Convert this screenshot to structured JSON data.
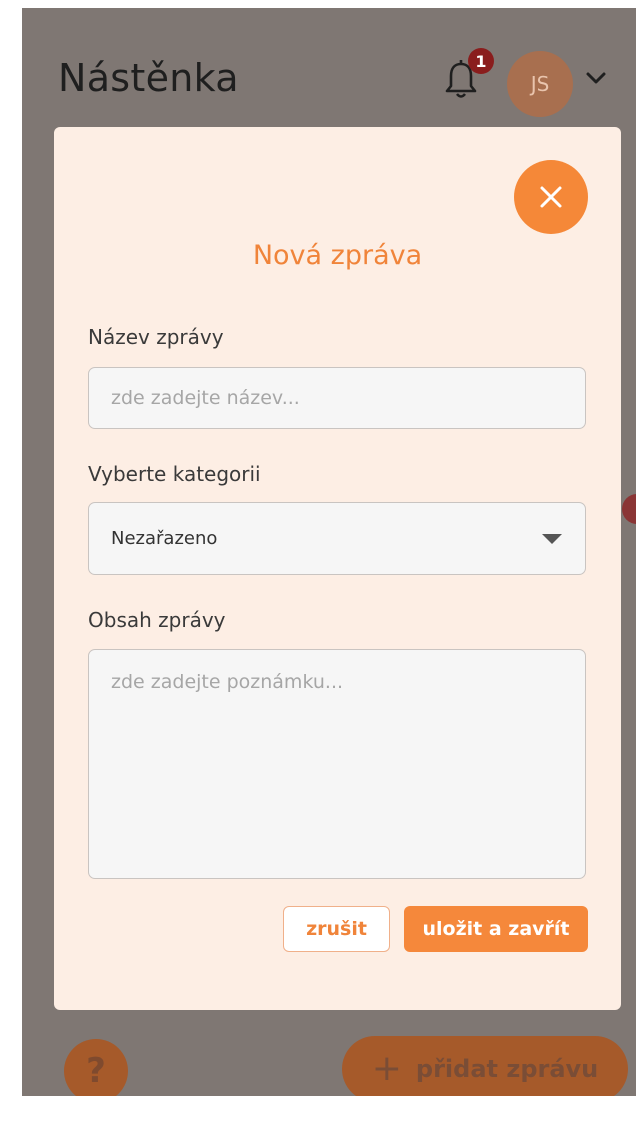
{
  "header": {
    "title": "Nástěnka",
    "notification_count": "1",
    "avatar_initials": "JS"
  },
  "modal": {
    "title": "Nová zpráva",
    "name_label": "Název zprávy",
    "name_placeholder": "zde zadejte název...",
    "name_value": "",
    "category_label": "Vyberte kategorii",
    "category_selected": "Nezařazeno",
    "content_label": "Obsah zprávy",
    "content_placeholder": "zde zadejte poznámku...",
    "content_value": "",
    "cancel_label": "zrušit",
    "save_label": "uložit a zavřít"
  },
  "footer": {
    "help_label": "?",
    "add_label": "přidat zprávu"
  },
  "colors": {
    "accent": "#f5883b",
    "modal_bg": "#fdeee4",
    "overlay": "#7f7773",
    "badge": "#8a1d1d"
  },
  "icons": [
    "bell-icon",
    "chevron-down-icon",
    "close-icon",
    "caret-down-icon",
    "plus-icon"
  ]
}
